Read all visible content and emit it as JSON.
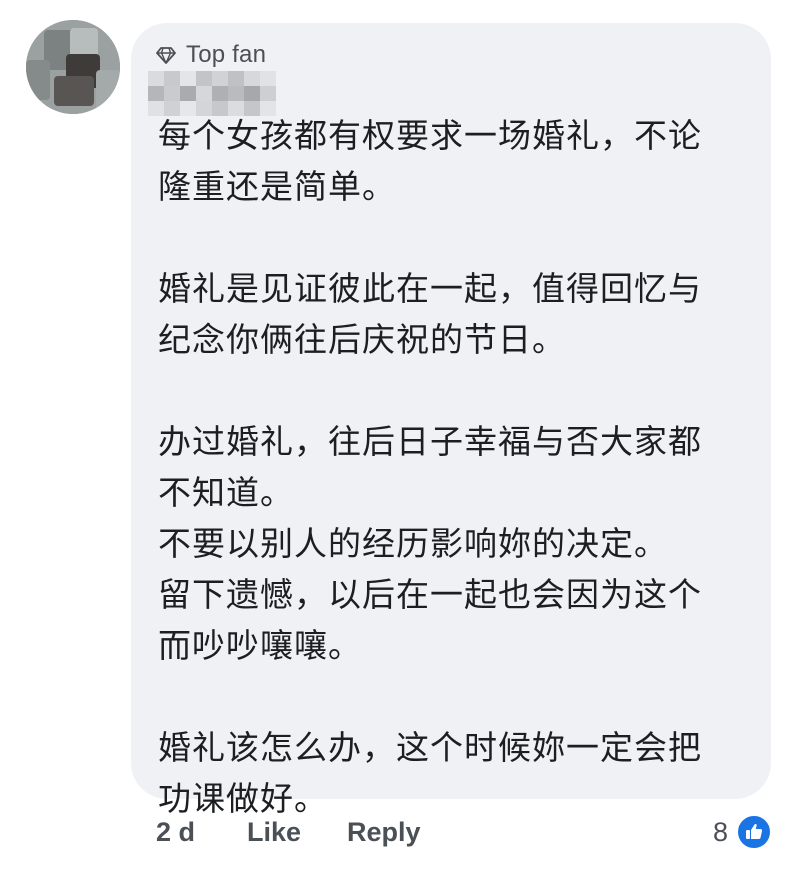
{
  "comment": {
    "badge": "Top fan",
    "badge_icon": "diamond-icon",
    "paragraphs": [
      [
        "每个女孩都有权要求一场婚礼，不论",
        "隆重还是简单。"
      ],
      [
        "婚礼是见证彼此在一起，值得回忆与",
        "纪念你俩往后庆祝的节日。"
      ],
      [
        "办过婚礼，往后日子幸福与否大家都",
        "不知道。",
        "不要以别人的经历影响妳的决定。",
        "留下遗憾，以后在一起也会因为这个",
        "而吵吵嚷嚷。"
      ],
      [
        "婚礼该怎么办，这个时候妳一定会把",
        "功课做好。"
      ]
    ]
  },
  "actions": {
    "time": "2 d",
    "like": "Like",
    "reply": "Reply"
  },
  "reactions": {
    "count": "8",
    "icon": "thumbs-up-icon",
    "color": "#1b74e4"
  },
  "colors": {
    "bubble": "#eff1f4",
    "text": "#1c1e21",
    "secondary_text": "#4b4f56"
  }
}
